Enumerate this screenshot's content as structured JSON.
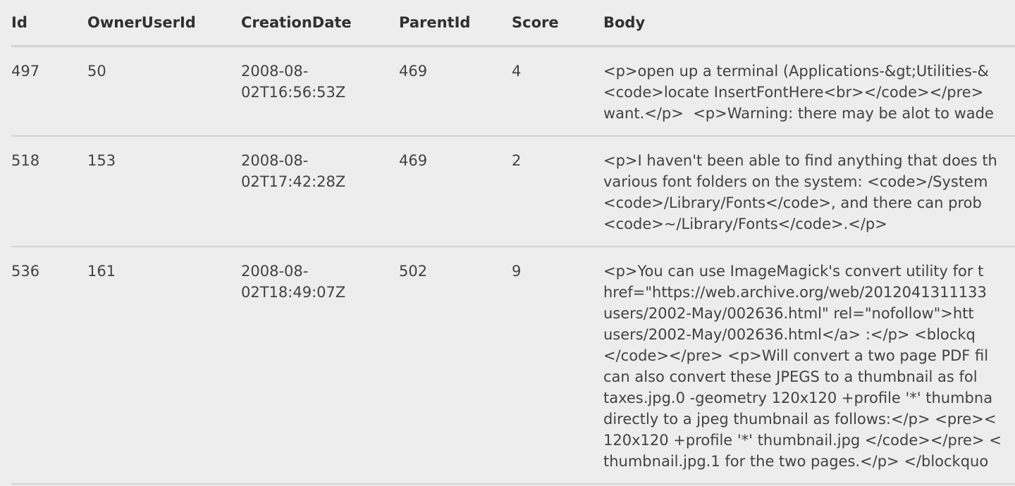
{
  "table": {
    "headers": [
      "Id",
      "OwnerUserId",
      "CreationDate",
      "ParentId",
      "Score",
      "Body"
    ],
    "rows": [
      {
        "id": "497",
        "owner_user_id": "50",
        "creation_date_lines": [
          "2008-08-",
          "02T16:56:53Z"
        ],
        "parent_id": "469",
        "score": "4",
        "body_lines": [
          "<p>open up a terminal (Applications-&gt;Utilities-&",
          "<code>locate InsertFontHere<br></code></pre>",
          "want.</p>  <p>Warning: there may be alot to wade"
        ]
      },
      {
        "id": "518",
        "owner_user_id": "153",
        "creation_date_lines": [
          "2008-08-",
          "02T17:42:28Z"
        ],
        "parent_id": "469",
        "score": "2",
        "body_lines": [
          "<p>I haven't been able to find anything that does th",
          "various font folders on the system: <code>/System",
          "<code>/Library/Fonts</code>, and there can prob",
          "<code>~/Library/Fonts</code>.</p>"
        ]
      },
      {
        "id": "536",
        "owner_user_id": "161",
        "creation_date_lines": [
          "2008-08-",
          "02T18:49:07Z"
        ],
        "parent_id": "502",
        "score": "9",
        "body_lines": [
          "<p>You can use ImageMagick's convert utility for t",
          "href=\"https://web.archive.org/web/2012041311133",
          "users/2002-May/002636.html\" rel=\"nofollow\">htt",
          "users/2002-May/002636.html</a> :</p> <blockq",
          "</code></pre> <p>Will convert a two page PDF fil",
          "can also convert these JPEGS to a thumbnail as fol",
          "taxes.jpg.0 -geometry 120x120 +profile '*' thumbna",
          "directly to a jpeg thumbnail as follows:</p> <pre><",
          "120x120 +profile '*' thumbnail.jpg </code></pre> <",
          "thumbnail.jpg.1 for the two pages.</p> </blockquo"
        ]
      }
    ]
  }
}
